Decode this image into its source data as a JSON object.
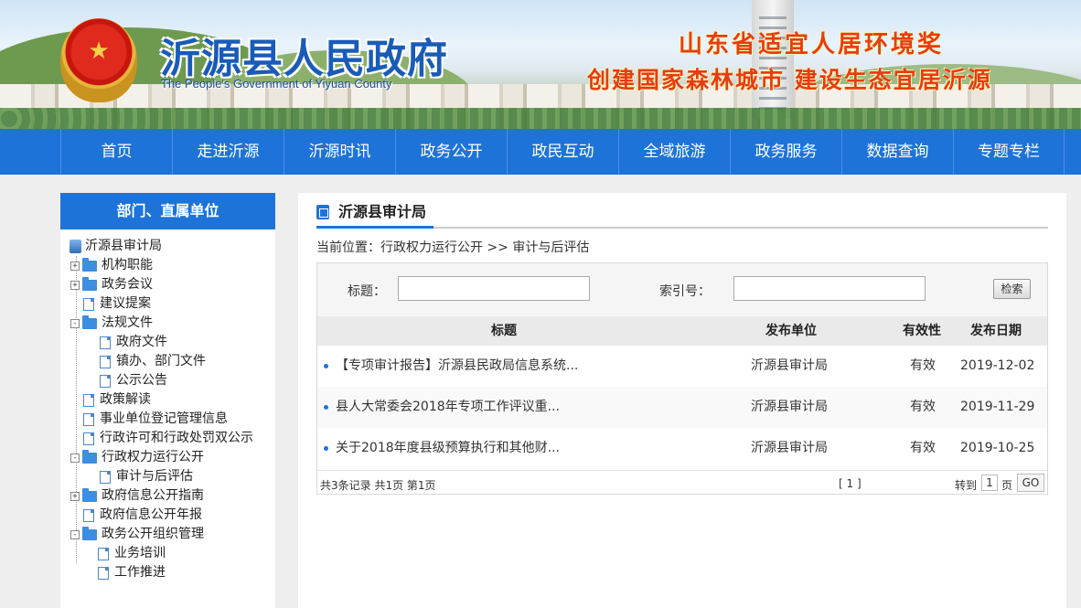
{
  "header": {
    "title": "沂源县人民政府",
    "subtitle": "The People's Government of Yiyuan County",
    "slogan1": "山东省适宜人居环境奖",
    "slogan2": "创建国家森林城市 建设生态宜居沂源"
  },
  "nav": {
    "items": [
      "首页",
      "走进沂源",
      "沂源时讯",
      "政务公开",
      "政民互动",
      "全域旅游",
      "政务服务",
      "数据查询",
      "专题专栏"
    ]
  },
  "sidebar": {
    "title": "部门、直属单位",
    "root": "沂源县审计局",
    "items": [
      {
        "label": "机构职能",
        "toggle": "+",
        "type": "folder"
      },
      {
        "label": "政务会议",
        "toggle": "+",
        "type": "folder"
      },
      {
        "label": "建议提案",
        "toggle": "",
        "type": "doc"
      },
      {
        "label": "法规文件",
        "toggle": "-",
        "type": "folder"
      },
      {
        "label": "政府文件",
        "toggle": "",
        "type": "doc"
      },
      {
        "label": "镇办、部门文件",
        "toggle": "",
        "type": "doc"
      },
      {
        "label": "公示公告",
        "toggle": "",
        "type": "doc"
      },
      {
        "label": "政策解读",
        "toggle": "",
        "type": "doc"
      },
      {
        "label": "事业单位登记管理信息",
        "toggle": "",
        "type": "doc"
      },
      {
        "label": "行政许可和行政处罚双公示",
        "toggle": "",
        "type": "doc"
      },
      {
        "label": "行政权力运行公开",
        "toggle": "-",
        "type": "folder"
      },
      {
        "label": "审计与后评估",
        "toggle": "",
        "type": "doc"
      },
      {
        "label": "政府信息公开指南",
        "toggle": "+",
        "type": "folder"
      },
      {
        "label": "政府信息公开年报",
        "toggle": "",
        "type": "doc"
      },
      {
        "label": "政务公开组织管理",
        "toggle": "-",
        "type": "folder"
      },
      {
        "label": "业务培训",
        "toggle": "",
        "type": "doc"
      },
      {
        "label": "工作推进",
        "toggle": "",
        "type": "doc"
      }
    ]
  },
  "main": {
    "tab_title": "沂源县审计局",
    "breadcrumb": "当前位置：行政权力运行公开 >> 审计与后评估",
    "search": {
      "title_label": "标题：",
      "title_value": "",
      "index_label": "索引号：",
      "index_value": "",
      "button": "检索"
    },
    "table": {
      "headers": {
        "title": "标题",
        "unit": "发布单位",
        "valid": "有效性",
        "date": "发布日期"
      },
      "rows": [
        {
          "title": "【专项审计报告】沂源县民政局信息系统...",
          "unit": "沂源县审计局",
          "valid": "有效",
          "date": "2019-12-02"
        },
        {
          "title": "县人大常委会2018年专项工作评议重...",
          "unit": "沂源县审计局",
          "valid": "有效",
          "date": "2019-11-29"
        },
        {
          "title": "关于2018年度县级预算执行和其他财...",
          "unit": "沂源县审计局",
          "valid": "有效",
          "date": "2019-10-25"
        }
      ]
    },
    "pager": {
      "summary": "共3条记录  共1页  第1页",
      "pages": "[ 1 ]",
      "goto_label": "转到",
      "page_value": "1",
      "page_unit": "页",
      "go": "GO"
    }
  },
  "colors": {
    "primary_blue": "#1e73d9",
    "slogan_red": "#e63c16",
    "title_blue": "#1a5bb8"
  }
}
